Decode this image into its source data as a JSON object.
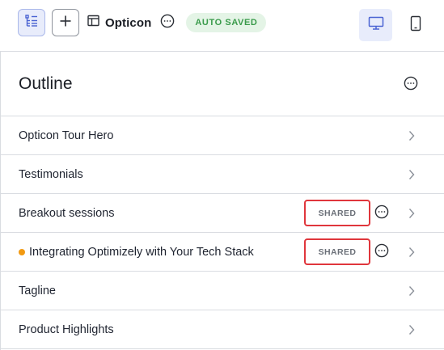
{
  "toolbar": {
    "title": "Opticon",
    "status_badge": "AUTO SAVED",
    "icons": {
      "outline": "outline-tree-icon",
      "add": "plus-icon",
      "layout": "layout-template-icon",
      "more": "more-horizontal-icon",
      "desktop": "desktop-icon",
      "mobile": "mobile-icon"
    }
  },
  "outline": {
    "title": "Outline",
    "items": [
      {
        "label": "Opticon Tour Hero"
      },
      {
        "label": "Testimonials"
      },
      {
        "label": "Breakout sessions",
        "badge": "SHARED"
      },
      {
        "label": "Integrating Optimizely with Your Tech Stack",
        "badge": "SHARED",
        "modified_dot": true
      },
      {
        "label": "Tagline"
      },
      {
        "label": "Product Highlights"
      }
    ]
  },
  "colors": {
    "accent": "#4a63d3",
    "active_bg": "#e8ecfb",
    "badge_bg": "#e4f4e6",
    "badge_text": "#3a9b4b",
    "highlight_border": "#e0363c",
    "modified_dot": "#f29a12"
  }
}
